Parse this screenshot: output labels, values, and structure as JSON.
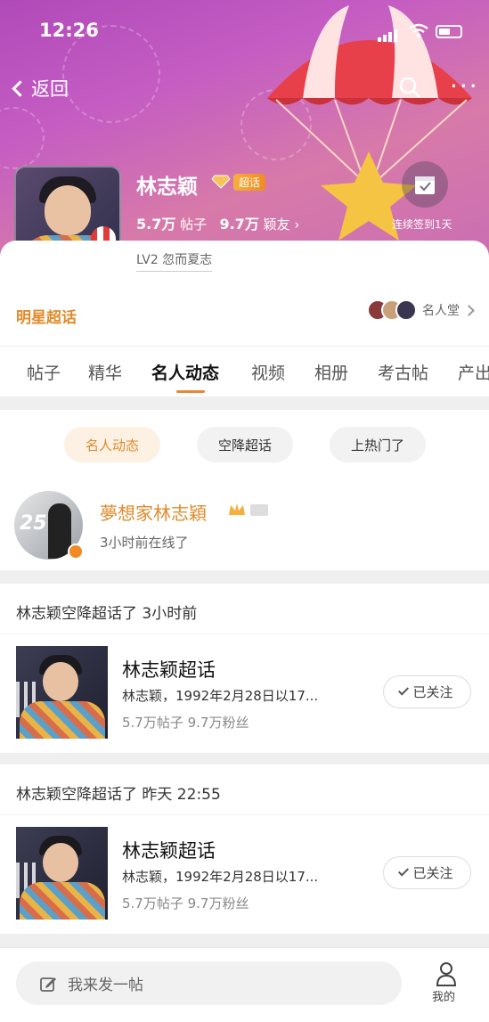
{
  "status_bar": {
    "time": "12:26"
  },
  "nav": {
    "back_label": "返回"
  },
  "topic": {
    "name": "林志颖",
    "badge": "超话",
    "posts_count": "5.7万",
    "posts_label": "帖子",
    "members_count": "9.7万",
    "members_label": "颖友",
    "members_arrow": "›",
    "checkin_label": "连续签到1天",
    "level": "LV2 忽而夏志",
    "category": "明星超话",
    "hall_label": "名人堂"
  },
  "tabs": [
    {
      "label": "帖子"
    },
    {
      "label": "精华"
    },
    {
      "label": "名人动态",
      "active": true
    },
    {
      "label": "视频"
    },
    {
      "label": "相册"
    },
    {
      "label": "考古帖"
    },
    {
      "label": "产出"
    }
  ],
  "filters": [
    {
      "label": "名人动态",
      "active": true
    },
    {
      "label": "空降超话"
    },
    {
      "label": "上热门了"
    }
  ],
  "celebrity": {
    "avatar_text": "25",
    "name": "夢想家林志穎",
    "status": "3小时前在线了"
  },
  "feed": [
    {
      "title": "林志颖空降超话了 3小时前",
      "topic_title": "林志颖超话",
      "topic_desc": "林志颖，1992年2月28日以17...",
      "topic_stats": "5.7万帖子  9.7万粉丝",
      "follow_label": "已关注"
    },
    {
      "title": "林志颖空降超话了 昨天 22:55",
      "topic_title": "林志颖超话",
      "topic_desc": "林志颖，1992年2月28日以17...",
      "topic_stats": "5.7万帖子  9.7万粉丝",
      "follow_label": "已关注"
    }
  ],
  "bottom": {
    "compose_placeholder": "我来发一帖",
    "me_label": "我的"
  },
  "colors": {
    "accent": "#e08b2c",
    "header_gradient_start": "#b04ab8",
    "header_gradient_end": "#d77aa9"
  }
}
